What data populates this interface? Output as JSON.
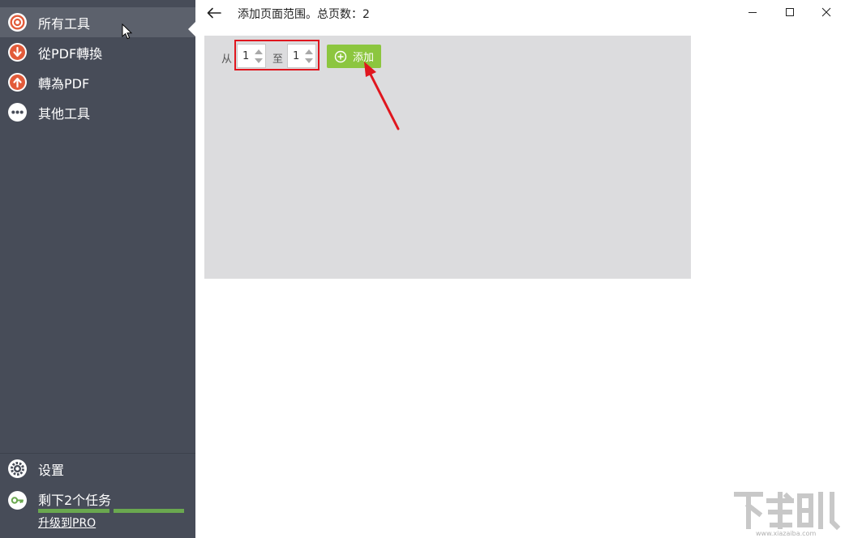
{
  "sidebar": {
    "items": [
      {
        "label": "所有工具",
        "icon": "target-icon",
        "active": true
      },
      {
        "label": "從PDF轉換",
        "icon": "arrow-down-circle-icon"
      },
      {
        "label": "轉為PDF",
        "icon": "arrow-up-circle-icon"
      },
      {
        "label": "其他工具",
        "icon": "more-dots-icon"
      }
    ],
    "settings_label": "设置",
    "tasks_label": "剩下2个任务",
    "upgrade_label": "升级到PRO",
    "task_progress": [
      1,
      1
    ]
  },
  "header": {
    "title": "添加页面范围。总页数：2"
  },
  "range": {
    "from_label": "从",
    "from_value": "1",
    "to_label": "至",
    "to_value": "1",
    "add_label": "添加"
  },
  "watermark": {
    "text": "www.xiazaiba.com"
  },
  "colors": {
    "sidebar_bg": "#474c58",
    "sidebar_active": "#5c616c",
    "accent_green": "#8cc63f",
    "progress_green": "#6aa84f",
    "icon_red": "#e25b3a",
    "highlight_red": "#e0161e",
    "panel_bg": "#dcdcde"
  }
}
